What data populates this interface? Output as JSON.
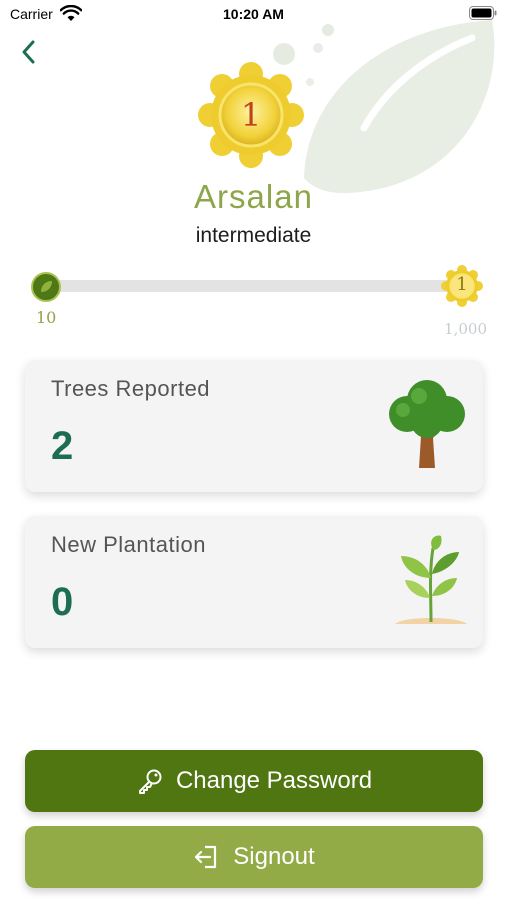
{
  "status_bar": {
    "carrier": "Carrier",
    "time": "10:20 AM"
  },
  "profile": {
    "rank": "1",
    "name": "Arsalan",
    "level": "intermediate"
  },
  "progress": {
    "min_label": "10",
    "max_label": "1,000",
    "end_badge": "1"
  },
  "stats": {
    "trees_reported": {
      "title": "Trees Reported",
      "value": "2",
      "icon": "tree-icon"
    },
    "new_plantation": {
      "title": "New Plantation",
      "value": "0",
      "icon": "sprout-icon"
    }
  },
  "actions": {
    "change_password": {
      "label": "Change Password",
      "icon": "key-icon"
    },
    "signout": {
      "label": "Signout",
      "icon": "signout-icon"
    }
  },
  "colors": {
    "brand_dark": "#4f7610",
    "brand_light": "#93ab47",
    "name_green": "#8ea64a",
    "value_green": "#1d6e51"
  }
}
